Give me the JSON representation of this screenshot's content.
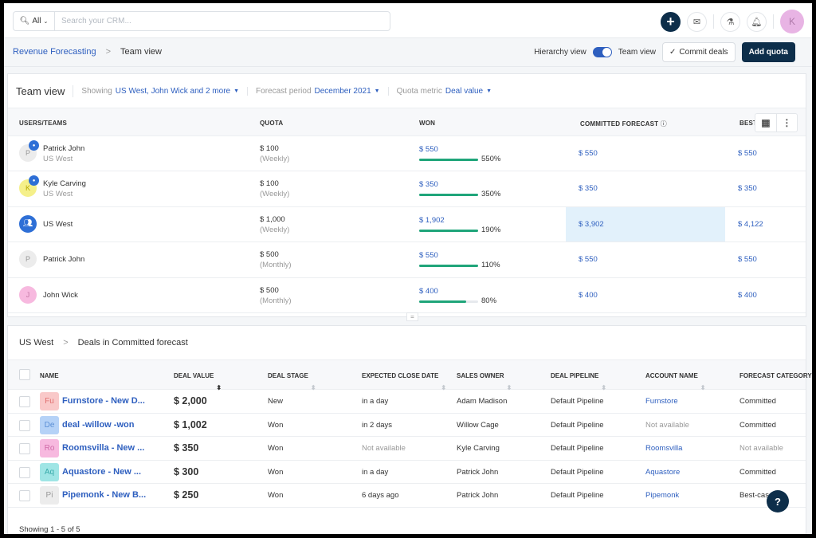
{
  "topbar": {
    "search_scope": "All",
    "search_placeholder": "Search your CRM...",
    "icons": [
      "plus-icon",
      "mail-icon",
      "flask-icon",
      "bell-icon"
    ],
    "user_initial": "K"
  },
  "breadcrumb": {
    "parent": "Revenue Forecasting",
    "separator": ">",
    "current": "Team view"
  },
  "actions": {
    "hierarchy_label": "Hierarchy view",
    "team_label": "Team view",
    "toggle_on": true,
    "commit_label": "Commit deals",
    "add_quota_label": "Add quota"
  },
  "team_view": {
    "title": "Team view",
    "filters": [
      {
        "label": "Showing",
        "value": "US West, John Wick and 2 more"
      },
      {
        "label": "Forecast period",
        "value": "December 2021"
      },
      {
        "label": "Quota metric",
        "value": "Deal value"
      }
    ],
    "columns": [
      "USERS/TEAMS",
      "QUOTA",
      "WON",
      "COMMITTED FORECAST",
      "BEST-CASE FORECAST"
    ],
    "rows": [
      {
        "initial": "P",
        "name": "Patrick John",
        "team": "US West",
        "quota": "$ 100",
        "period": "(Weekly)",
        "won": "$ 550",
        "won_pct_label": "550%",
        "progress": 1.0,
        "committed": "$ 550",
        "best": "$ 550",
        "avatar_bg": "#ececec",
        "avatar_fg": "#999999",
        "has_badge": true
      },
      {
        "initial": "K",
        "name": "Kyle Carving",
        "team": "US West",
        "quota": "$ 100",
        "period": "(Weekly)",
        "won": "$ 350",
        "won_pct_label": "350%",
        "progress": 1.0,
        "committed": "$ 350",
        "best": "$ 350",
        "avatar_bg": "#f5f08a",
        "avatar_fg": "#b8a800",
        "has_badge": true
      },
      {
        "initial": "team-icon",
        "name": "US West",
        "team": "",
        "quota": "$ 1,000",
        "period": "(Weekly)",
        "won": "$ 1,902",
        "won_pct_label": "190%",
        "progress": 1.0,
        "committed": "$ 3,902",
        "best": "$ 4,122",
        "avatar_bg": "#2e6fd6",
        "avatar_fg": "#ffffff",
        "has_badge": false,
        "highlight": true
      },
      {
        "initial": "P",
        "name": "Patrick John",
        "team": "",
        "quota": "$ 500",
        "period": "(Monthly)",
        "won": "$ 550",
        "won_pct_label": "110%",
        "progress": 1.0,
        "committed": "$ 550",
        "best": "$ 550",
        "avatar_bg": "#ececec",
        "avatar_fg": "#999999",
        "has_badge": false
      },
      {
        "initial": "J",
        "name": "John Wick",
        "team": "",
        "quota": "$ 500",
        "period": "(Monthly)",
        "won": "$ 400",
        "won_pct_label": "80%",
        "progress": 0.8,
        "committed": "$ 400",
        "best": "$ 400",
        "avatar_bg": "#f7b9df",
        "avatar_fg": "#c77aa8",
        "has_badge": false
      }
    ]
  },
  "deals": {
    "crumb_parent": "US West",
    "crumb_separator": ">",
    "crumb_current": "Deals in Committed forecast",
    "columns": [
      "NAME",
      "DEAL VALUE",
      "DEAL STAGE",
      "EXPECTED CLOSE DATE",
      "SALES OWNER",
      "DEAL PIPELINE",
      "ACCOUNT NAME",
      "FORECAST CATEGORY"
    ],
    "rows": [
      {
        "abbr": "Fu",
        "abbr_bg": "#f9c9c9",
        "abbr_fg": "#e07070",
        "name": "Furnstore - New D...",
        "value": "$ 2,000",
        "stage": "New",
        "close": "in a day",
        "close_na": false,
        "owner": "Adam Madison",
        "pipeline": "Default Pipeline",
        "account": "Furnstore",
        "account_na": false,
        "category": "Committed",
        "category_na": false
      },
      {
        "abbr": "De",
        "abbr_bg": "#b5d2f7",
        "abbr_fg": "#5b8fd6",
        "name": "deal -willow -won",
        "value": "$ 1,002",
        "stage": "Won",
        "close": "in 2 days",
        "close_na": false,
        "owner": "Willow Cage",
        "pipeline": "Default Pipeline",
        "account": "Not available",
        "account_na": true,
        "category": "Committed",
        "category_na": false
      },
      {
        "abbr": "Ro",
        "abbr_bg": "#f7b9df",
        "abbr_fg": "#d06aa8",
        "name": "Roomsvilla - New ...",
        "value": "$ 350",
        "stage": "Won",
        "close": "Not available",
        "close_na": true,
        "owner": "Kyle Carving",
        "pipeline": "Default Pipeline",
        "account": "Roomsvilla",
        "account_na": false,
        "category": "Not available",
        "category_na": true
      },
      {
        "abbr": "Aq",
        "abbr_bg": "#9fe5e5",
        "abbr_fg": "#3aabab",
        "name": "Aquastore - New ...",
        "value": "$ 300",
        "stage": "Won",
        "close": "in a day",
        "close_na": false,
        "owner": "Patrick John",
        "pipeline": "Default Pipeline",
        "account": "Aquastore",
        "account_na": false,
        "category": "Committed",
        "category_na": false
      },
      {
        "abbr": "Pi",
        "abbr_bg": "#ececec",
        "abbr_fg": "#999999",
        "name": "Pipemonk - New B...",
        "value": "$ 250",
        "stage": "Won",
        "close": "6 days ago",
        "close_na": false,
        "owner": "Patrick John",
        "pipeline": "Default Pipeline",
        "account": "Pipemonk",
        "account_na": false,
        "category": "Best-case",
        "category_na": false
      }
    ],
    "footer": "Showing 1 - 5 of 5"
  },
  "help_label": "?"
}
